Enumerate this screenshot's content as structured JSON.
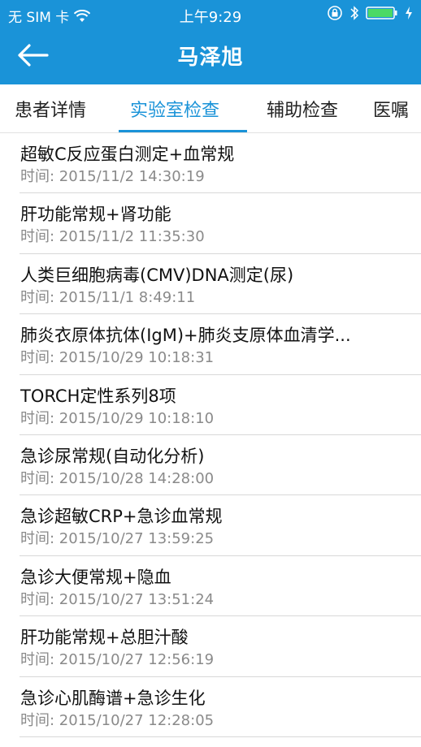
{
  "status_bar": {
    "carrier": "无 SIM 卡",
    "time": "上午9:29"
  },
  "nav": {
    "title": "马泽旭"
  },
  "tabs": [
    {
      "label": "患者详情"
    },
    {
      "label": "实验室检查"
    },
    {
      "label": "辅助检查"
    },
    {
      "label": "医嘱"
    }
  ],
  "active_tab": "实验室检查",
  "items": [
    {
      "name": "超敏C反应蛋白测定+血常规",
      "time": "时间:  2015/11/2 14:30:19"
    },
    {
      "name": "肝功能常规+肾功能",
      "time": "时间:  2015/11/2 11:35:30"
    },
    {
      "name": "人类巨细胞病毒(CMV)DNA测定(尿)",
      "time": "时间:  2015/11/1 8:49:11"
    },
    {
      "name": "肺炎衣原体抗体(IgM)+肺炎支原体血清学...",
      "time": "时间:  2015/10/29 10:18:31"
    },
    {
      "name": "TORCH定性系列8项",
      "time": "时间:  2015/10/29 10:18:10"
    },
    {
      "name": "急诊尿常规(自动化分析)",
      "time": "时间:  2015/10/28 14:28:00"
    },
    {
      "name": "急诊超敏CRP+急诊血常规",
      "time": "时间:  2015/10/27 13:59:25"
    },
    {
      "name": "急诊大便常规+隐血",
      "time": "时间:  2015/10/27 13:51:24"
    },
    {
      "name": "肝功能常规+总胆汁酸",
      "time": "时间:  2015/10/27 12:56:19"
    },
    {
      "name": "急诊心肌酶谱+急诊生化",
      "time": "时间:  2015/10/27 12:28:05"
    }
  ],
  "colors": {
    "primary": "#1a93d8",
    "text": "#111111",
    "secondary_text": "#8a8a8a",
    "divider": "#d8d8d8"
  }
}
